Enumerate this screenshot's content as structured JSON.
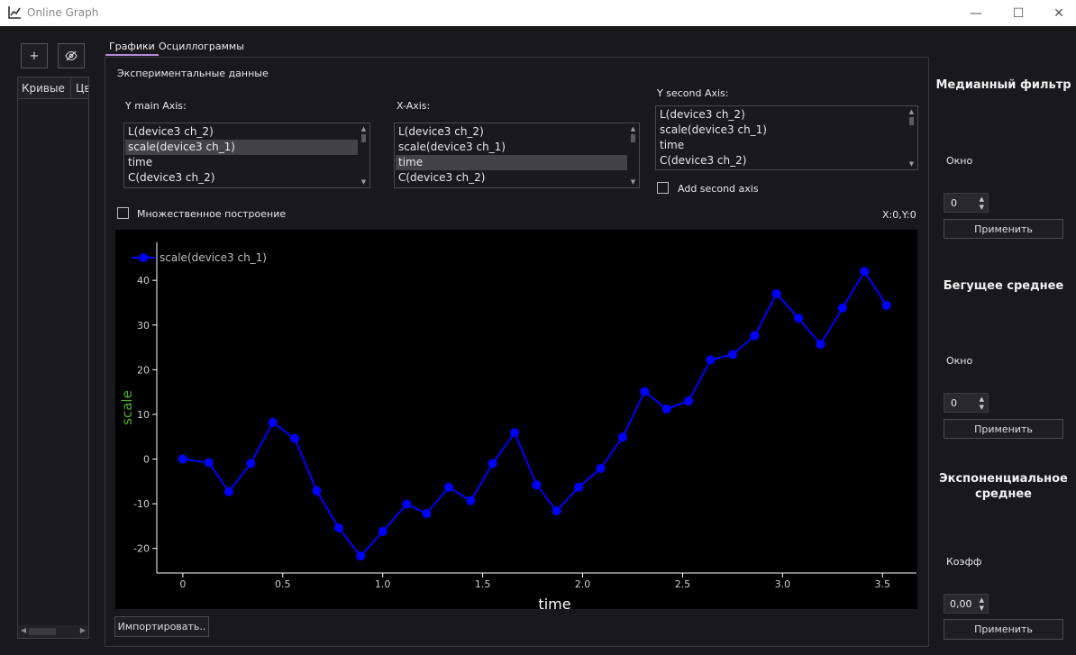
{
  "window": {
    "title": "Online Graph",
    "minimize": "—",
    "maximize": "☐",
    "close": "✕"
  },
  "left": {
    "add_button": "+",
    "visibility_icon": "eye-off-icon",
    "columns": [
      "Кривые",
      "Цв"
    ]
  },
  "tabs": [
    {
      "label": "Графики",
      "active": true
    },
    {
      "label": "Осциллограммы",
      "active": false
    }
  ],
  "main": {
    "section_title": "Экспериментальные данные",
    "y_main_label": "Y main Axis:",
    "x_axis_label": "X-Axis:",
    "y_second_label": "Y second Axis:",
    "y_main_items": [
      "L(device3 ch_2)",
      "scale(device3 ch_1)",
      "time",
      "C(device3 ch_2)"
    ],
    "y_main_selected": 1,
    "x_axis_items": [
      "L(device3 ch_2)",
      "scale(device3 ch_1)",
      "time",
      "C(device3 ch_2)"
    ],
    "x_axis_selected": 2,
    "y_second_items": [
      "L(device3 ch_2)",
      "scale(device3 ch_1)",
      "time",
      "C(device3 ch_2)"
    ],
    "add_second_axis": "Add second axis",
    "multi_plot": "Множественное построение",
    "coords": "X:0,Y:0",
    "import_button": "Импортировать.."
  },
  "right": {
    "median_title": "Медианный фильтр",
    "median_window_label": "Окно",
    "median_window_value": "0",
    "median_apply": "Применить",
    "running_title": "Бегущее среднее",
    "running_window_label": "Окно",
    "running_window_value": "0",
    "running_apply": "Применить",
    "exp_title": "Экспоненциальное среднее",
    "exp_coef_label": "Коэфф",
    "exp_coef_value": "0,00",
    "exp_apply": "Применить"
  },
  "chart_data": {
    "type": "line",
    "xlabel": "time",
    "ylabel": "scale",
    "xlim": [
      -0.13,
      3.67
    ],
    "ylim": [
      -25.5,
      48.5
    ],
    "xticks": [
      0,
      0.5,
      1.0,
      1.5,
      2.0,
      2.5,
      3.0,
      3.5
    ],
    "xtick_labels": [
      "0",
      "0.5",
      "1.0",
      "1.5",
      "2.0",
      "2.5",
      "3.0",
      "3.5"
    ],
    "yticks": [
      -20,
      -10,
      0,
      10,
      20,
      30,
      40
    ],
    "ytick_labels": [
      "-20",
      "-10",
      "0",
      "10",
      "20",
      "30",
      "40"
    ],
    "grid": false,
    "legend_position": "top-left",
    "series": [
      {
        "name": "scale(device3 ch_1)",
        "color": "#0000ff",
        "x": [
          0,
          0.13,
          0.23,
          0.34,
          0.45,
          0.56,
          0.67,
          0.78,
          0.89,
          1.0,
          1.12,
          1.22,
          1.33,
          1.44,
          1.55,
          1.66,
          1.77,
          1.87,
          1.98,
          2.09,
          2.2,
          2.31,
          2.42,
          2.53,
          2.64,
          2.75,
          2.86,
          2.97,
          3.08,
          3.19,
          3.3,
          3.41,
          3.52
        ],
        "y": [
          0,
          -0.8,
          -7.3,
          -1.0,
          8.2,
          4.6,
          -7.1,
          -15.4,
          -21.7,
          -16.2,
          -10.1,
          -12.2,
          -6.3,
          -9.3,
          -1.0,
          5.9,
          -5.8,
          -11.6,
          -6.3,
          -2.1,
          4.9,
          15.1,
          11.2,
          13.0,
          22.2,
          23.4,
          27.6,
          37.0,
          31.5,
          25.7,
          33.8,
          42.0,
          34.4
        ]
      }
    ]
  }
}
